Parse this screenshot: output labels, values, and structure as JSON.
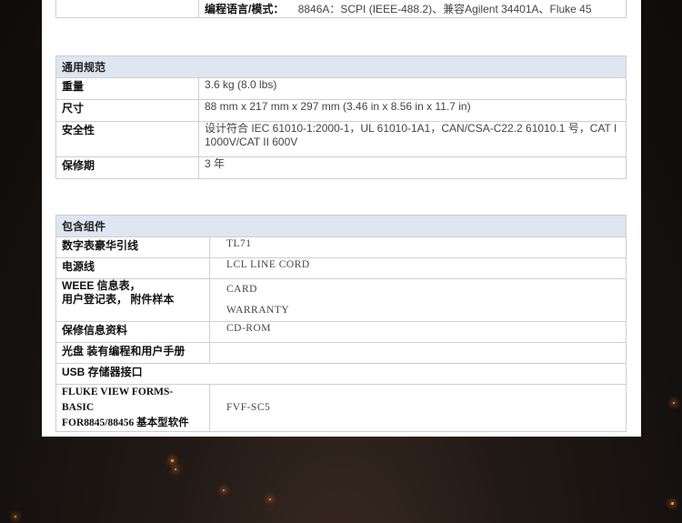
{
  "top_row": {
    "label": "编程语言/模式：",
    "value": "8846A：SCPI (IEEE-488.2)、兼容Agilent 34401A、Fluke 45"
  },
  "general": {
    "title": "通用规范",
    "rows": [
      {
        "label": "重量",
        "value": "3.6 kg (8.0 lbs)"
      },
      {
        "label": "尺寸",
        "value": "88 mm x 217 mm x 297 mm (3.46 in x 8.56 in x 11.7 in)"
      },
      {
        "label": "安全性",
        "value": "设计符合 IEC 61010-1:2000-1，UL 61010-1A1，CAN/CSA-C22.2 61010.1 号，CAT I 1000V/CAT II 600V"
      },
      {
        "label": "保修期",
        "value": "3 年"
      }
    ]
  },
  "included": {
    "title": "包含组件",
    "rows": [
      {
        "label": "数字表豪华引线",
        "value": "TL71"
      },
      {
        "label": "电源线",
        "value": "LCL LINE CORD"
      },
      {
        "label_line1": "WEEE 信息表，",
        "label_line2": "用户登记表， 附件样本",
        "value_line1": "CARD",
        "value_line2": "WARRANTY"
      },
      {
        "label": "保修信息资料",
        "value": "CD-ROM"
      },
      {
        "label": "光盘 装有编程和用户手册",
        "value": ""
      },
      {
        "label": "USB 存储器接口"
      },
      {
        "label_line1": "FLUKE VIEW FORMS-BASIC",
        "label_line2": "FOR8845/88456 基本型软件",
        "value": "FVF-SC5"
      }
    ]
  }
}
